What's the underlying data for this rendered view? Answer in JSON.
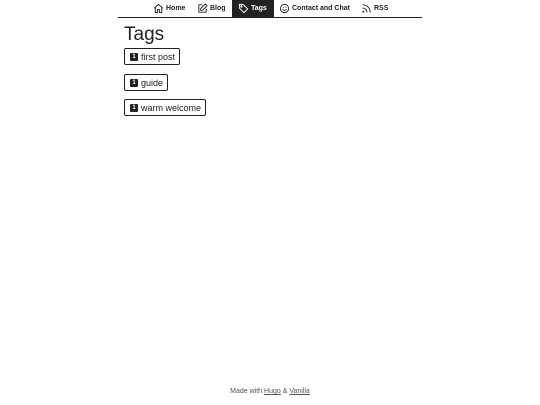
{
  "nav": {
    "items": [
      {
        "label": "Home",
        "icon": "home-icon",
        "active": false
      },
      {
        "label": "Blog",
        "icon": "edit-icon",
        "active": false
      },
      {
        "label": "Tags",
        "icon": "tag-icon",
        "active": true
      },
      {
        "label": "Contact and Chat",
        "icon": "smiley-icon",
        "active": false
      },
      {
        "label": "RSS",
        "icon": "rss-icon",
        "active": false
      }
    ]
  },
  "main": {
    "title": "Tags",
    "tags": [
      {
        "count": "1",
        "label": "first post"
      },
      {
        "count": "1",
        "label": "guide"
      },
      {
        "count": "1",
        "label": "warm welcome"
      }
    ]
  },
  "footer": {
    "prefix": "Made with",
    "link1": "Hugo",
    "separator": "&",
    "link2": "Vanilla"
  },
  "colors": {
    "text": "#222222",
    "background": "#ffffff",
    "active_nav_bg": "#222222"
  }
}
